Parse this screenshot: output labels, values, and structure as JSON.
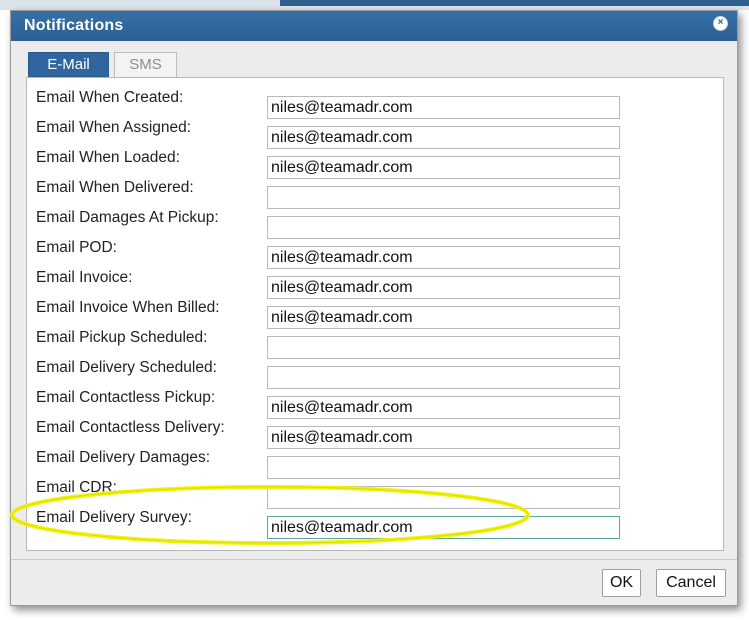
{
  "dialog": {
    "title": "Notifications",
    "close_glyph": "×"
  },
  "tabs": [
    {
      "label": "E-Mail",
      "active": true
    },
    {
      "label": "SMS",
      "active": false
    }
  ],
  "fields": [
    {
      "label": "Email When Created:",
      "value": "niles@teamadr.com"
    },
    {
      "label": "Email When Assigned:",
      "value": "niles@teamadr.com"
    },
    {
      "label": "Email When Loaded:",
      "value": "niles@teamadr.com"
    },
    {
      "label": "Email When Delivered:",
      "value": ""
    },
    {
      "label": "Email Damages At Pickup:",
      "value": ""
    },
    {
      "label": "Email POD:",
      "value": "niles@teamadr.com"
    },
    {
      "label": "Email Invoice:",
      "value": "niles@teamadr.com"
    },
    {
      "label": "Email Invoice When Billed:",
      "value": "niles@teamadr.com"
    },
    {
      "label": "Email Pickup Scheduled:",
      "value": ""
    },
    {
      "label": "Email Delivery Scheduled:",
      "value": ""
    },
    {
      "label": "Email Contactless Pickup:",
      "value": "niles@teamadr.com"
    },
    {
      "label": "Email Contactless Delivery:",
      "value": "niles@teamadr.com"
    },
    {
      "label": "Email Delivery Damages:",
      "value": ""
    },
    {
      "label": "Email CDR:",
      "value": ""
    },
    {
      "label": "Email Delivery Survey:",
      "value": "niles@teamadr.com",
      "focused": true
    }
  ],
  "buttons": {
    "ok_label": "OK",
    "cancel_label": "Cancel"
  },
  "colors": {
    "titlebar": "#2c5f93",
    "active_tab": "#2f66a0",
    "highlight_ellipse": "#f2f20a",
    "focused_field_border": "#5aa7a3"
  },
  "annotation": {
    "type": "highlight-ellipse",
    "target_field": "Email Delivery Survey:"
  }
}
